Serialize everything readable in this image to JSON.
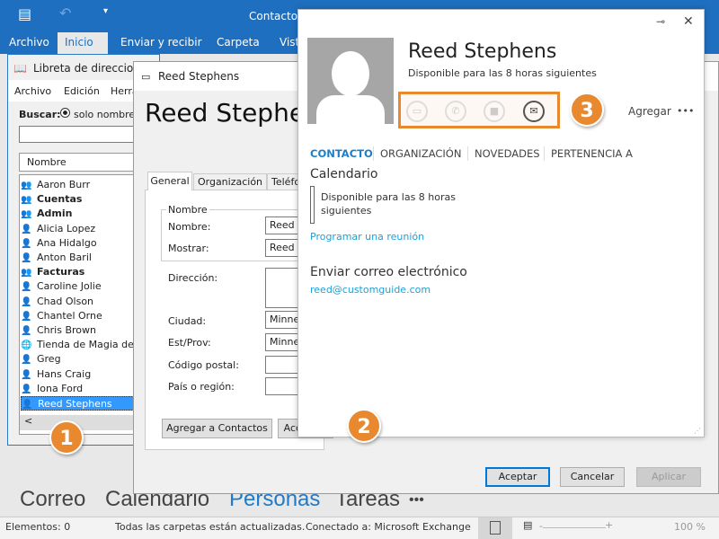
{
  "outlook": {
    "title": "Contactos",
    "ribbon_tabs": [
      "Archivo",
      "Inicio",
      "Enviar y recibir",
      "Carpeta",
      "Vista"
    ],
    "active_tab": "Inicio",
    "nav": [
      "Correo",
      "Calendario",
      "Personas",
      "Tareas",
      "•••"
    ],
    "active_nav": "Personas",
    "status": {
      "items": "Elementos: 0",
      "sync": "Todas las carpetas están actualizadas.",
      "connection": "Conectado a: Microsoft Exchange",
      "zoom": "100 %"
    }
  },
  "address_book": {
    "title": "Libreta de direcciones",
    "menu": [
      "Archivo",
      "Edición",
      "Herramientas"
    ],
    "search_label": "Buscar:",
    "search_option": "solo nombre",
    "column": "Nombre",
    "entries": [
      {
        "name": "Aaron Burr",
        "type": "group",
        "bold": false
      },
      {
        "name": "Cuentas",
        "type": "group",
        "bold": true
      },
      {
        "name": "Admin",
        "type": "group",
        "bold": true
      },
      {
        "name": "Alicia Lopez",
        "type": "person"
      },
      {
        "name": "Ana Hidalgo",
        "type": "person"
      },
      {
        "name": "Anton Baril",
        "type": "person"
      },
      {
        "name": "Facturas",
        "type": "group",
        "bold": true
      },
      {
        "name": "Caroline Jolie",
        "type": "person"
      },
      {
        "name": "Chad Olson",
        "type": "person"
      },
      {
        "name": "Chantel Orne",
        "type": "person"
      },
      {
        "name": "Chris Brown",
        "type": "person"
      },
      {
        "name": "Tienda de Magia de D",
        "type": "web"
      },
      {
        "name": "Greg",
        "type": "person"
      },
      {
        "name": "Hans Craig",
        "type": "person"
      },
      {
        "name": "Iona Ford",
        "type": "person"
      },
      {
        "name": "Reed Stephens",
        "type": "person",
        "selected": true
      }
    ]
  },
  "contact_dialog": {
    "title": "Reed Stephens",
    "heading": "Reed Stephens",
    "tabs": [
      "General",
      "Organización",
      "Teléfono"
    ],
    "group_label": "Nombre",
    "fields": {
      "nombre_label": "Nombre:",
      "nombre": "Reed",
      "mostrar_label": "Mostrar:",
      "mostrar": "Reed Stephens",
      "direccion_label": "Dirección:",
      "ciudad_label": "Ciudad:",
      "ciudad": "Minneapolis",
      "estado_label": "Est/Prov:",
      "estado": "Minnesota",
      "cp_label": "Código postal:",
      "pais_label": "País o región:"
    },
    "add_button": "Agregar a Contactos",
    "actions_button": "Acciones",
    "ok": "Aceptar",
    "cancel": "Cancelar",
    "apply": "Aplicar"
  },
  "card": {
    "name": "Reed Stephens",
    "status": "Disponible para las 8 horas siguientes",
    "add": "Agregar",
    "more": "•••",
    "tabs": [
      "CONTACTO",
      "ORGANIZACIÓN",
      "NOVEDADES",
      "PERTENENCIA A"
    ],
    "calendar_heading": "Calendario",
    "calendar_status": "Disponible para las 8 horas siguientes",
    "schedule_link": "Programar una reunión",
    "email_heading": "Enviar correo electrónico",
    "email": "reed@customguide.com",
    "icons": [
      "chat-icon",
      "phone-icon",
      "video-icon",
      "mail-icon"
    ]
  },
  "callouts": [
    "1",
    "2",
    "3"
  ],
  "colors": {
    "brand": "#1f6fc0",
    "callout": "#e8892f",
    "link": "#1ea0d6",
    "selection": "#3399ff"
  }
}
